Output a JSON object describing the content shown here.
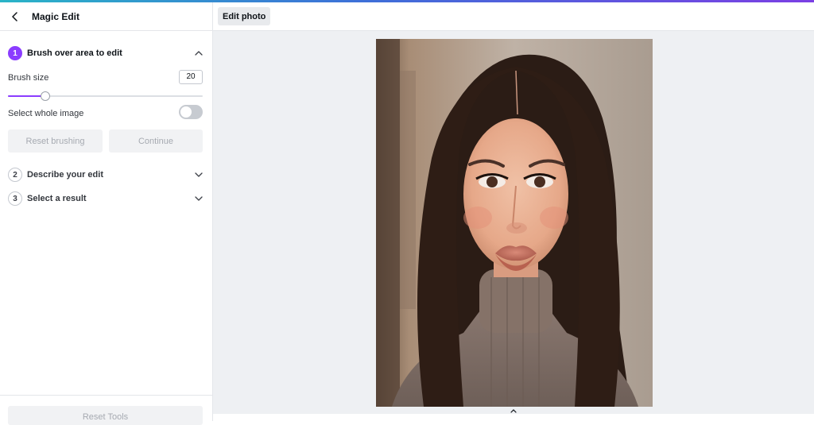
{
  "panel": {
    "title": "Magic Edit",
    "steps": [
      {
        "number": "1",
        "label": "Brush over area to edit",
        "expanded": true
      },
      {
        "number": "2",
        "label": "Describe your edit",
        "expanded": false
      },
      {
        "number": "3",
        "label": "Select a result",
        "expanded": false
      }
    ],
    "brush": {
      "label": "Brush size",
      "value": "20",
      "slider_fraction": 0.19
    },
    "select_whole": {
      "label": "Select whole image",
      "enabled": false
    },
    "buttons": {
      "reset": "Reset brushing",
      "continue": "Continue"
    },
    "footer": {
      "reset_tools": "Reset Tools"
    }
  },
  "main": {
    "toolbar": {
      "edit_photo": "Edit photo"
    }
  },
  "colors": {
    "accent": "#8b3dff",
    "canvas_bg": "#eef0f3",
    "disabled_text": "#a6aab1"
  },
  "icons": [
    "back-arrow-icon",
    "chevron-up-icon",
    "chevron-down-icon",
    "collapse-caret-icon"
  ]
}
